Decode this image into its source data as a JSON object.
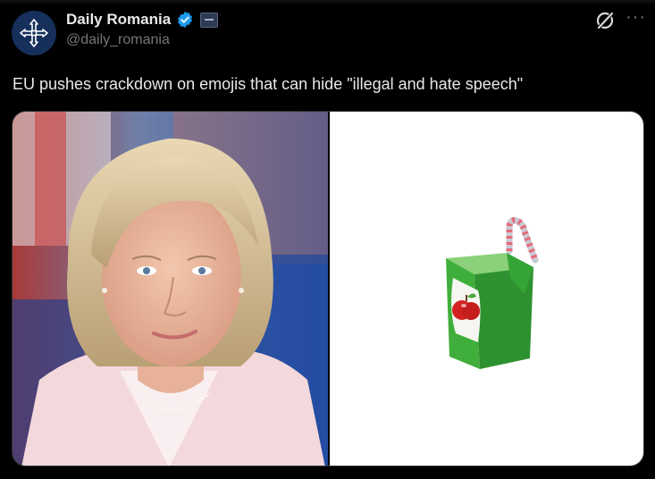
{
  "author": {
    "display_name": "Daily Romania",
    "handle": "@daily_romania",
    "verified_icon": "verified-badge-icon",
    "affiliation_icon": "affiliation-flag-icon",
    "avatar_icon": "four-arrows-cross-icon"
  },
  "actions": {
    "grok_icon": "grok-icon",
    "more_icon": "more-icon",
    "more_label": "···"
  },
  "tweet": {
    "text": "EU pushes crackdown on emojis that can hide \"illegal and hate speech\""
  },
  "media": [
    {
      "description_icon": "portrait-photo"
    },
    {
      "description_icon": "juice-box-emoji"
    }
  ],
  "colors": {
    "background": "#000000",
    "text": "#e7e9ea",
    "secondary_text": "#71767b",
    "verified_blue": "#1d9bf0",
    "avatar_bg": "#16305b"
  }
}
